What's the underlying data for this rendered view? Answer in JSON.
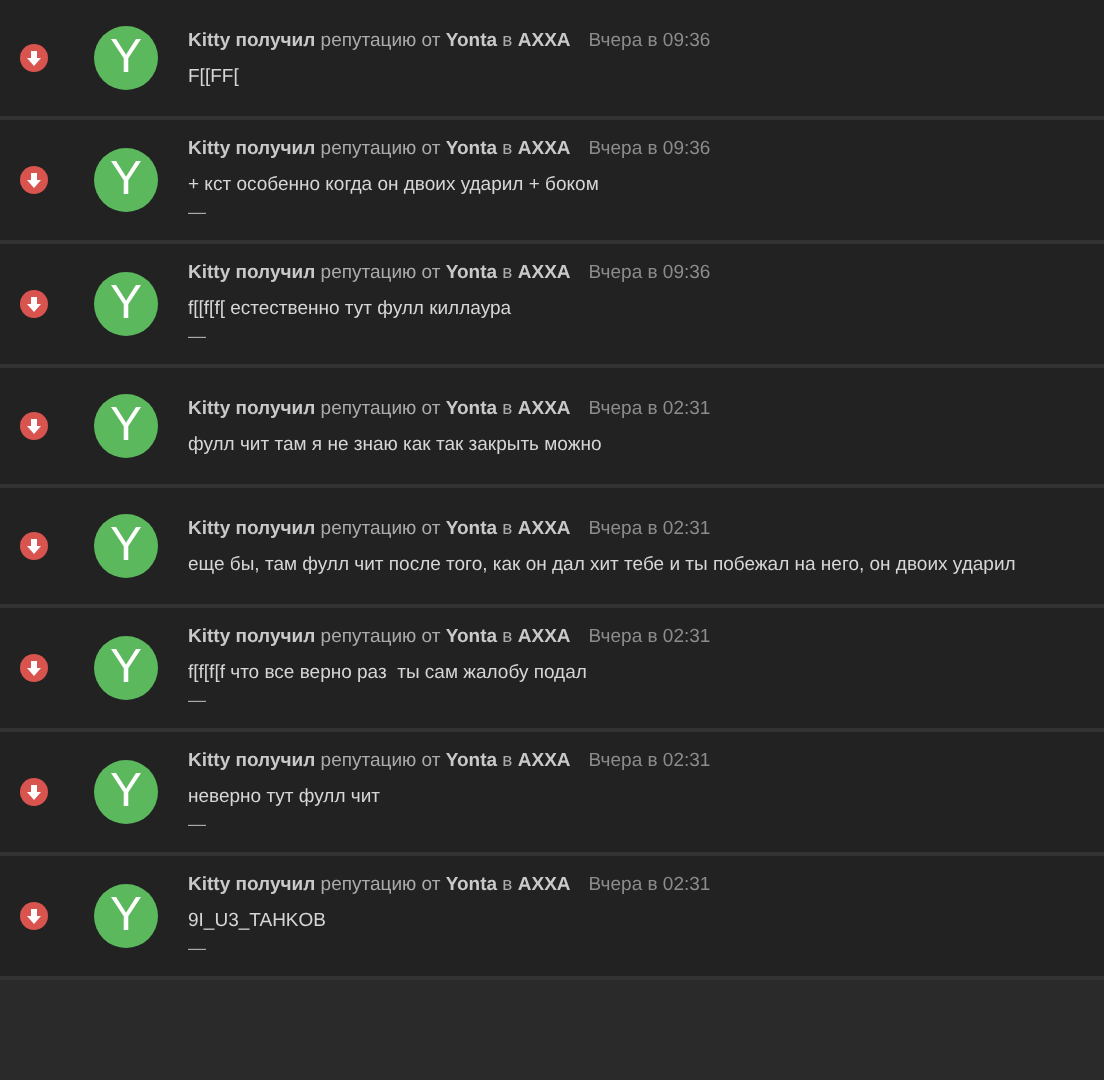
{
  "items": [
    {
      "kind": "negative",
      "avatar": {
        "letter": "Y",
        "color": "#5cb85c"
      },
      "title": "**Kitty получил** репутацию от **Yonta** в **AXXA**",
      "date": "Вчера в 09:36",
      "message": "F[[FF["
    },
    {
      "kind": "negative",
      "avatar": {
        "letter": "Y",
        "color": "#5cb85c"
      },
      "title": "**Kitty получил** репутацию от **Yonta** в **AXXA**",
      "date": "Вчера в 09:36",
      "message": "+ кст особенно когда он двоих ударил + боком",
      "signature": "—"
    },
    {
      "kind": "negative",
      "avatar": {
        "letter": "Y",
        "color": "#5cb85c"
      },
      "title": "**Kitty получил** репутацию от **Yonta** в **AXXA**",
      "date": "Вчера в 09:36",
      "message": "f[[f[f[ естественно тут фулл киллаура",
      "signature": "—"
    },
    {
      "kind": "negative",
      "avatar": {
        "letter": "Y",
        "color": "#5cb85c"
      },
      "title": "**Kitty получил** репутацию от **Yonta** в **AXXA**",
      "date": "Вчера в 02:31",
      "message": "фулл чит там я не знаю как так закрыть можно"
    },
    {
      "kind": "negative",
      "avatar": {
        "letter": "Y",
        "color": "#5cb85c"
      },
      "title": "**Kitty получил** репутацию от **Yonta** в **AXXA**",
      "date": "Вчера в 02:31",
      "message": "еще бы, там фулл чит после того, как он дал хит тебе и ты побежал на него, он двоих ударил"
    },
    {
      "kind": "negative",
      "avatar": {
        "letter": "Y",
        "color": "#5cb85c"
      },
      "title": "**Kitty получил** репутацию от **Yonta** в **AXXA**",
      "date": "Вчера в 02:31",
      "message": "f[f[f[f что все верно раз  ты сам жалобу подал",
      "signature": "—"
    },
    {
      "kind": "negative",
      "avatar": {
        "letter": "Y",
        "color": "#5cb85c"
      },
      "title": "**Kitty получил** репутацию от **Yonta** в **AXXA**",
      "date": "Вчера в 02:31",
      "message": "неверно тут фулл чит",
      "signature": "—"
    },
    {
      "kind": "negative",
      "avatar": {
        "letter": "Y",
        "color": "#5cb85c"
      },
      "title": "**Kitty получил** репутацию от **Yonta** в **AXXA**",
      "date": "Вчера в 02:31",
      "message": "9I_U3_TAHKOB",
      "signature": "—"
    }
  ]
}
